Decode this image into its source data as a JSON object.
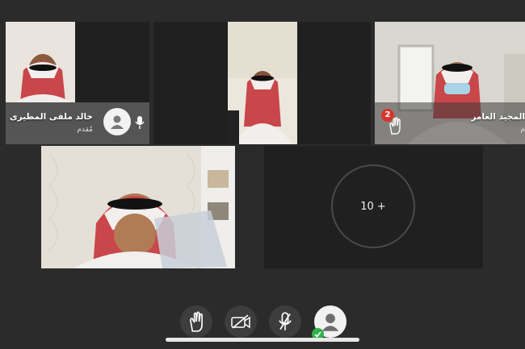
{
  "participants": [
    {
      "name": "خالد ملفى المطيرى",
      "role": "مُقدم"
    },
    {
      "name": "المجيد العامر",
      "role": "م",
      "raised_hand_count": "2"
    },
    {
      "name": "",
      "role": ""
    },
    {
      "name": "",
      "role": ""
    }
  ],
  "overflow_tile": {
    "label": "10 +"
  },
  "toolbar": {
    "icons": [
      "raise-hand-icon",
      "camera-off-icon",
      "mic-off-icon",
      "profile-icon"
    ]
  },
  "colors": {
    "background": "#2b2b2b",
    "tile": "#202020",
    "badge": "#d9342b",
    "check": "#2fb24b"
  }
}
